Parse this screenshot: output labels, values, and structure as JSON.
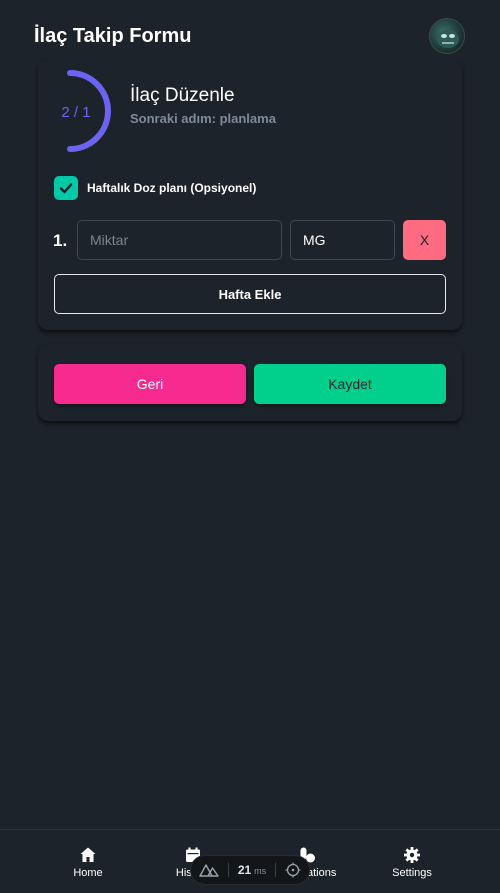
{
  "header": {
    "title": "İlaç Takip Formu"
  },
  "step": {
    "progress_text": "2 / 1",
    "title": "İlaç Düzenle",
    "subtitle": "Sonraki adım: planlama",
    "accent_color": "#6a64f1"
  },
  "weekly_plan": {
    "checked": true,
    "label": "Haftalık Doz planı (Opsiyonel)",
    "rows": [
      {
        "index": "1.",
        "amount_placeholder": "Miktar",
        "amount_value": "",
        "unit": "MG",
        "remove_label": "X"
      }
    ],
    "add_week_label": "Hafta Ekle"
  },
  "actions": {
    "back_label": "Geri",
    "save_label": "Kaydet",
    "back_color": "#f72a8f",
    "save_color": "#00d08c"
  },
  "nav": {
    "items": [
      {
        "label": "Home",
        "icon": "home-icon"
      },
      {
        "label": "History",
        "icon": "calendar-icon"
      },
      {
        "label": "Medications",
        "icon": "pills-icon"
      },
      {
        "label": "Settings",
        "icon": "gear-icon"
      }
    ]
  },
  "devtools": {
    "ms_value": "21",
    "ms_unit": "ms",
    "logo_icon": "nuxt-icon",
    "inspect_icon": "crosshair-icon"
  }
}
